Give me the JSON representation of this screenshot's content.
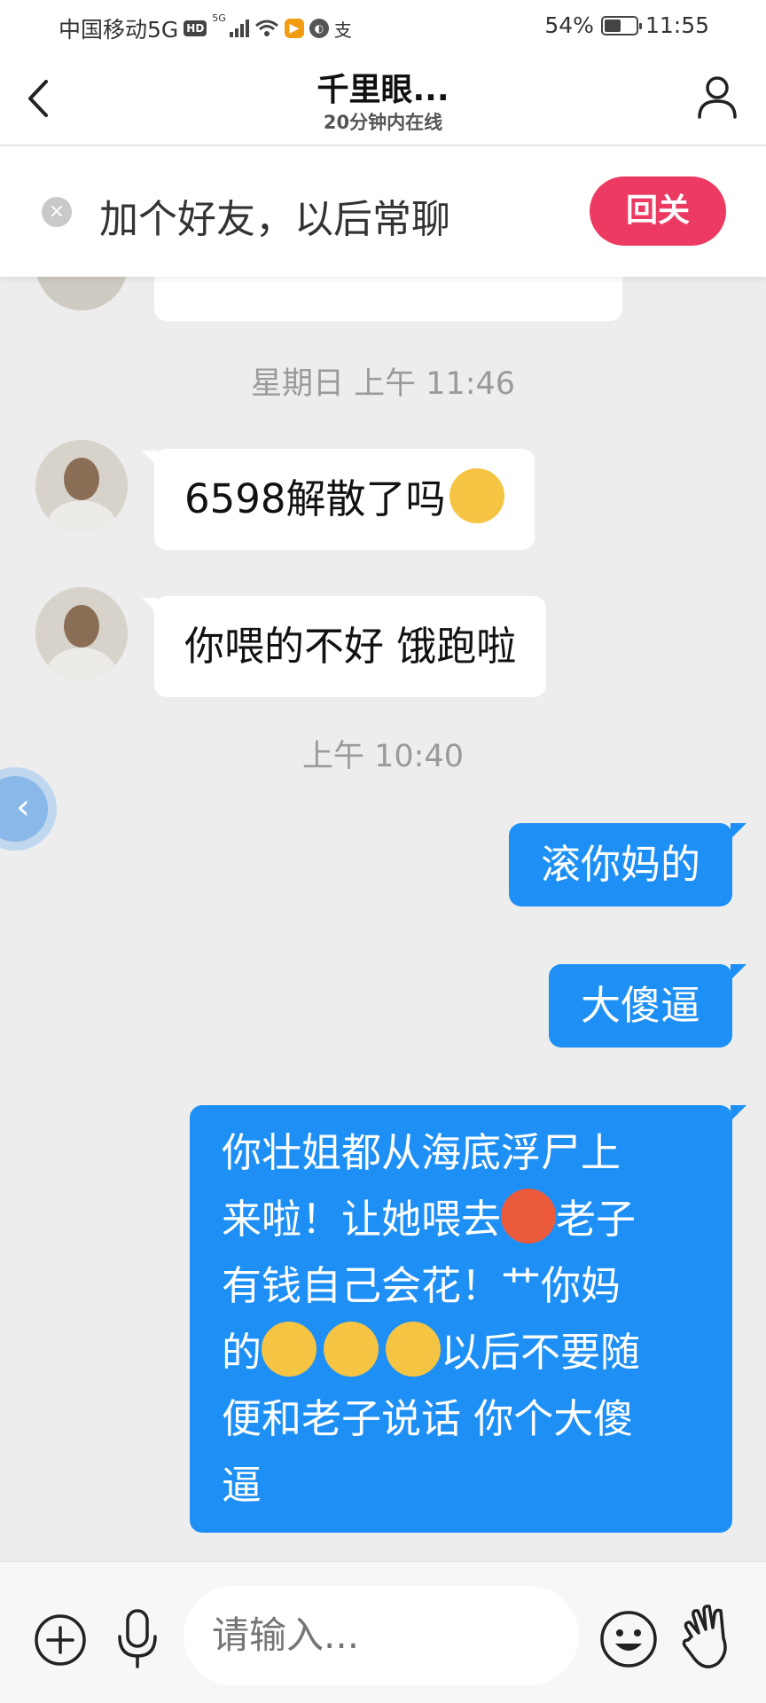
{
  "status_bar": {
    "carrier": "中国移动5G",
    "hd_badge": "HD",
    "signal_label": "5G",
    "extra_icon": "支",
    "battery": "54%",
    "time": "11:55",
    "battery_level": 0.54
  },
  "header": {
    "title": "千里眼...",
    "subtitle": "20分钟内在线"
  },
  "banner": {
    "text": "加个好友，以后常聊",
    "button": "回关"
  },
  "messages": {
    "time_1": "星期日 上午 11:46",
    "in_1": "6598解散了吗",
    "in_2": "你喂的不好 饿跑啦",
    "time_2": "上午 10:40",
    "out_1": "滚你妈的",
    "out_2": "大傻逼",
    "out_3_line1": "你壮姐都从海底浮尸上",
    "out_3_line2a": "来啦！让她喂去",
    "out_3_line2b": "老子",
    "out_3_line3": "有钱自己会花！艹你妈",
    "out_3_line4a": "的",
    "out_3_line4b": "以后不要随",
    "out_3_line5": "便和老子说话 你个大傻",
    "out_3_line6": "逼"
  },
  "input": {
    "placeholder": "请输入..."
  },
  "colors": {
    "accent_blue": "#1e90f5",
    "follow_red": "#ec3a62"
  },
  "icons": [
    "back-icon",
    "profile-icon",
    "close-icon",
    "plus-icon",
    "mic-icon",
    "emoji-icon",
    "wave-icon"
  ]
}
